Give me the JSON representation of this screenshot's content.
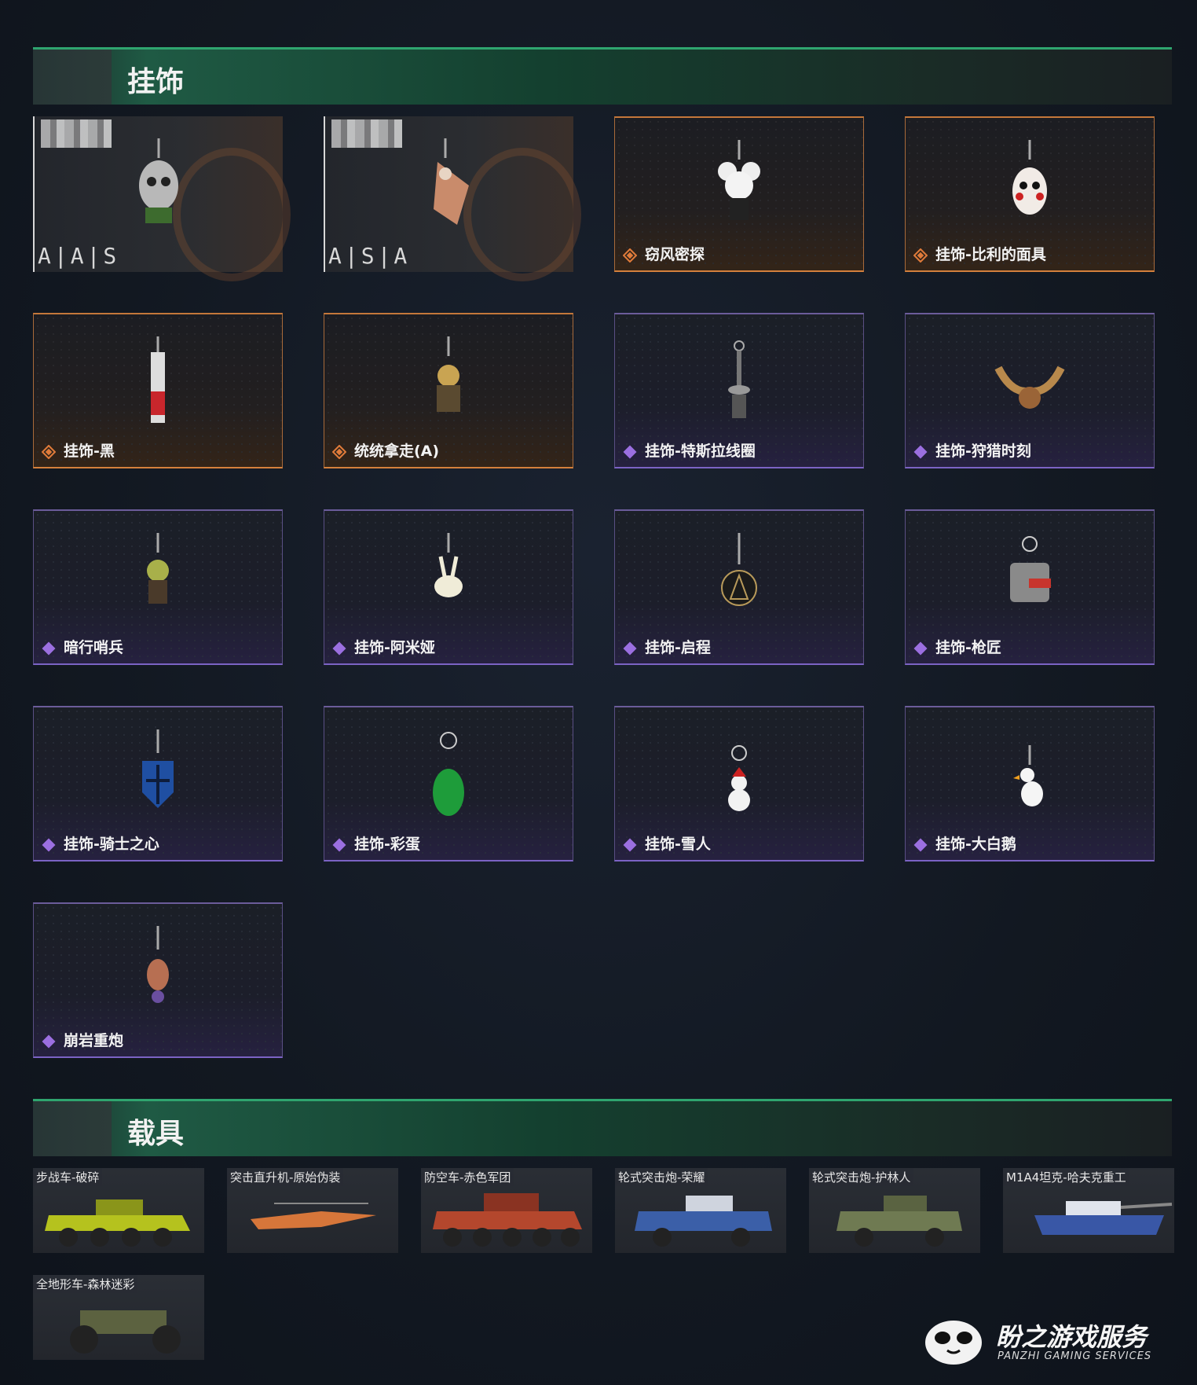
{
  "sections": {
    "charms_title": "挂饰",
    "vehicles_title": "载具"
  },
  "special_cards": [
    {
      "code": "A|A|S"
    },
    {
      "code": "A|S|A"
    }
  ],
  "charms": [
    {
      "label": "窃风密探",
      "rarity": "orange"
    },
    {
      "label": "挂饰-比利的面具",
      "rarity": "orange"
    },
    {
      "label": "挂饰-黑",
      "rarity": "orange"
    },
    {
      "label": "统统拿走(A)",
      "rarity": "orange"
    },
    {
      "label": "挂饰-特斯拉线圈",
      "rarity": "purple"
    },
    {
      "label": "挂饰-狩猎时刻",
      "rarity": "purple"
    },
    {
      "label": "暗行哨兵",
      "rarity": "purple"
    },
    {
      "label": "挂饰-阿米娅",
      "rarity": "purple"
    },
    {
      "label": "挂饰-启程",
      "rarity": "purple"
    },
    {
      "label": "挂饰-枪匠",
      "rarity": "purple"
    },
    {
      "label": "挂饰-骑士之心",
      "rarity": "purple"
    },
    {
      "label": "挂饰-彩蛋",
      "rarity": "purple"
    },
    {
      "label": "挂饰-雪人",
      "rarity": "purple"
    },
    {
      "label": "挂饰-大白鹅",
      "rarity": "purple"
    },
    {
      "label": "崩岩重炮",
      "rarity": "purple"
    }
  ],
  "vehicles": [
    {
      "label": "步战车-破碎",
      "color": "#b5c21e"
    },
    {
      "label": "突击直升机-原始伪装",
      "color": "#d6763a"
    },
    {
      "label": "防空车-赤色军团",
      "color": "#b4472d"
    },
    {
      "label": "轮式突击炮-荣耀",
      "color": "#3b5fa8"
    },
    {
      "label": "轮式突击炮-护林人",
      "color": "#6f7a52"
    },
    {
      "label": "M1A4坦克-哈夫克重工",
      "color": "#3957a6"
    },
    {
      "label": "全地形车-森林迷彩",
      "color": "#5c6240"
    }
  ],
  "watermark": {
    "title": "盼之游戏服务",
    "subtitle": "PANZHI GAMING SERVICES"
  },
  "colors": {
    "accent_green": "#2fa56f",
    "rarity_orange": "#e07b3a",
    "rarity_purple": "#9b6fe0"
  }
}
